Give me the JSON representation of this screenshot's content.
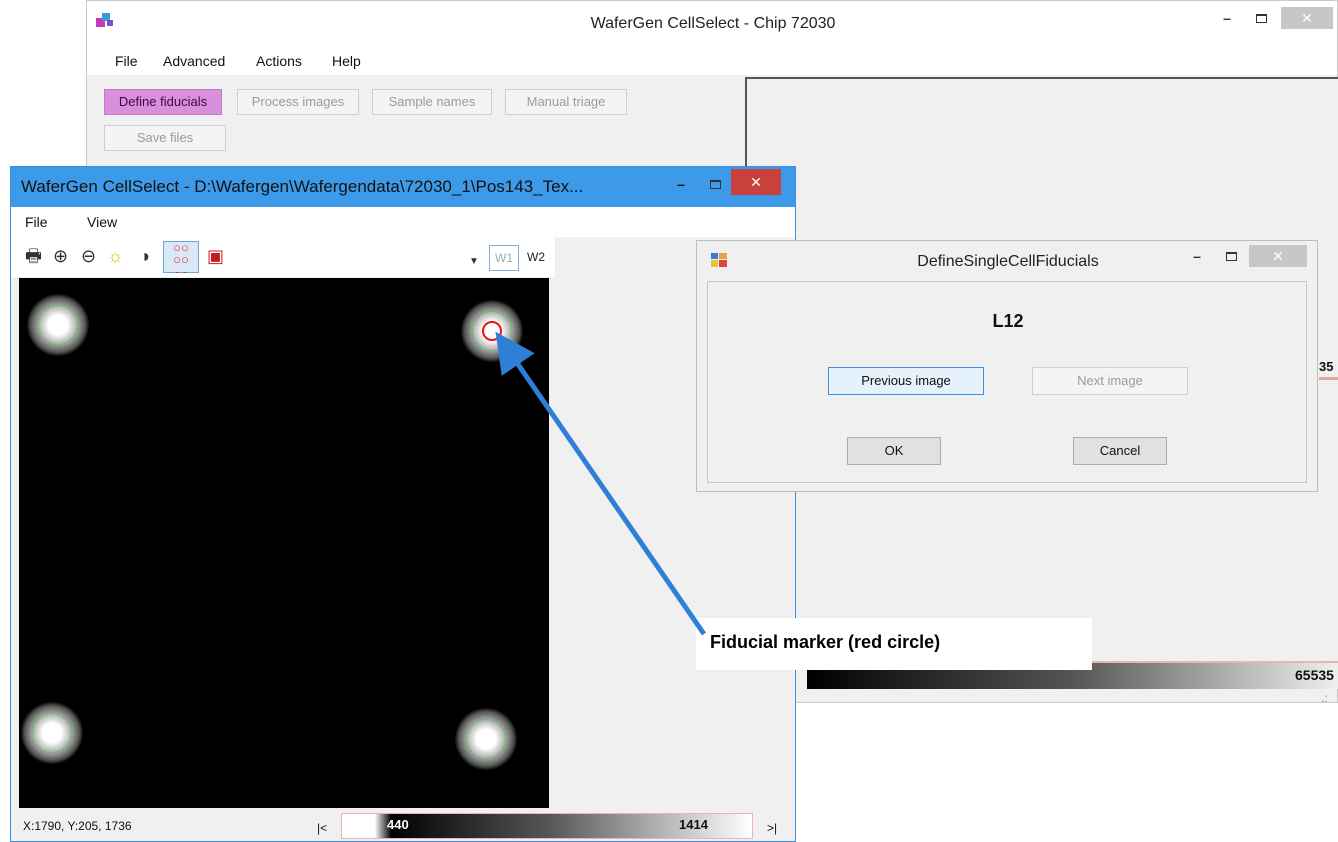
{
  "main_window": {
    "title": "WaferGen CellSelect - Chip 72030",
    "menu": [
      "File",
      "Advanced",
      "Actions",
      "Help"
    ],
    "buttons": {
      "define_fiducials": "Define fiducials",
      "process_images": "Process images",
      "sample_names": "Sample names",
      "manual_triage": "Manual triage",
      "save_files": "Save files"
    },
    "side_value": "35",
    "gradient_max": "65535",
    "resize_grip": ".:"
  },
  "viewer_window": {
    "title": "WaferGen CellSelect - D:\\Wafergen\\Wafergendata\\72030_1\\Pos143_Tex...",
    "menu": [
      "File",
      "View"
    ],
    "tabs": [
      "W1",
      "W2"
    ],
    "status": "X:1790, Y:205, 1736",
    "first_label": "|<",
    "last_label": ">|",
    "gradient_min": "440",
    "gradient_max": "1414",
    "toolbar_icons": [
      "print-icon",
      "zoom-in-icon",
      "zoom-out-icon",
      "brightness-icon",
      "contrast-icon",
      "fiducial-dots-icon",
      "camera-icon",
      "dropdown-icon"
    ]
  },
  "dialog": {
    "title": "DefineSingleCellFiducials",
    "label": "L12",
    "buttons": {
      "previous": "Previous image",
      "next": "Next image",
      "ok": "OK",
      "cancel": "Cancel"
    }
  },
  "annotation": {
    "text": "Fiducial marker (red circle)"
  },
  "colors": {
    "define_button_bg": "#d98fdc",
    "viewer_titlebar": "#3d9ae8",
    "viewer_close": "#c9413a",
    "fiducial_red": "#ee1111",
    "spot_ring_green": "#3fcf3f",
    "arrow_blue": "#2f7fd6"
  }
}
